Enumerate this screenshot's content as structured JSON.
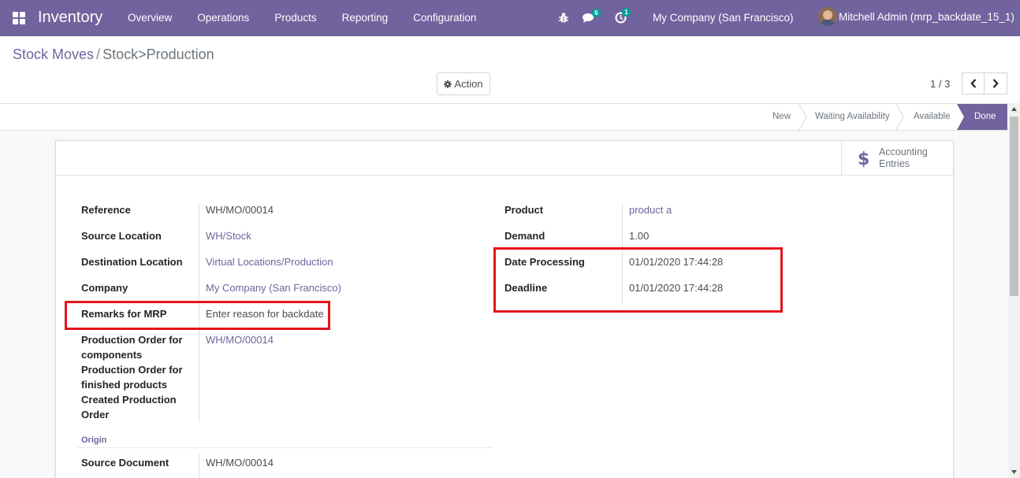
{
  "navbar": {
    "app_name": "Inventory",
    "menu": [
      "Overview",
      "Operations",
      "Products",
      "Reporting",
      "Configuration"
    ],
    "chat_count": "6",
    "activity_count": "1",
    "company": "My Company (San Francisco)",
    "user": "Mitchell Admin (mrp_backdate_15_1)",
    "accent_color": "#71639e"
  },
  "breadcrumb": {
    "parent": "Stock Moves",
    "separator": "/",
    "current": "Stock>Production"
  },
  "control": {
    "action_label": "Action",
    "pager": "1 / 3"
  },
  "statusbar": {
    "stages": [
      "New",
      "Waiting Availability",
      "Available"
    ],
    "active_stage": "Done"
  },
  "buttons": {
    "accounting": "Accounting Entries"
  },
  "form": {
    "left": [
      {
        "label": "Reference",
        "value": "WH/MO/00014"
      },
      {
        "label": "Source Location",
        "value": "WH/Stock"
      },
      {
        "label": "Destination Location",
        "value": "Virtual Locations/Production"
      },
      {
        "label": "Company",
        "value": "My Company (San Francisco)"
      },
      {
        "label": "Remarks for MRP",
        "value": "Enter reason for backdate"
      },
      {
        "label": "Production Order for components",
        "value": "WH/MO/00014"
      },
      {
        "label": "Production Order for finished products",
        "value": ""
      },
      {
        "label": "Created Production Order",
        "value": ""
      }
    ],
    "origin_title": "Origin",
    "origin": [
      {
        "label": "Source Document",
        "value": "WH/MO/00014"
      }
    ],
    "right": [
      {
        "label": "Product",
        "value": "product a"
      },
      {
        "label": "Demand",
        "value": "1.00"
      },
      {
        "label": "Date Processing",
        "value": "01/01/2020 17:44:28"
      },
      {
        "label": "Deadline",
        "value": "01/01/2020 17:44:28"
      }
    ]
  },
  "highlight_color": "#e4141b"
}
